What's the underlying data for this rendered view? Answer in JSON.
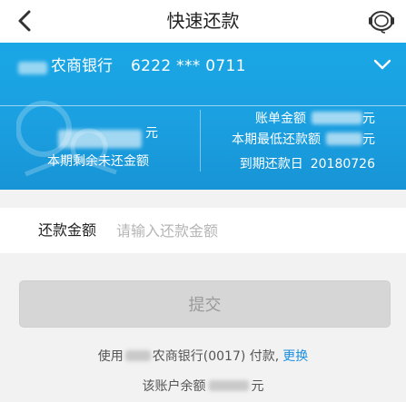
{
  "header": {
    "title": "快速还款",
    "icons": {
      "back": "chevron-left-icon",
      "service": "headset-icon"
    }
  },
  "card": {
    "bank_name": "农商银行",
    "card_number": "6222 *** 0711",
    "remaining_unit": "元",
    "remaining_label": "本期剩余未还金额",
    "bill_amount_label": "账单金额",
    "bill_amount_unit": "元",
    "min_payment_label": "本期最低还款额",
    "min_payment_unit": "元",
    "due_date_label": "到期还款日",
    "due_date": "20180726",
    "colors": {
      "background": "#1aa7e6",
      "text": "#ffffff"
    }
  },
  "form": {
    "amount_label": "还款金额",
    "amount_placeholder": "请输入还款金额",
    "amount_value": "",
    "submit_label": "提交"
  },
  "payment": {
    "prefix": "使用",
    "account": "农商银行(0017) 付款,",
    "change_label": "更换",
    "balance_prefix": "该账户余额",
    "balance_unit": "元",
    "link_color": "#1a8fe0"
  }
}
